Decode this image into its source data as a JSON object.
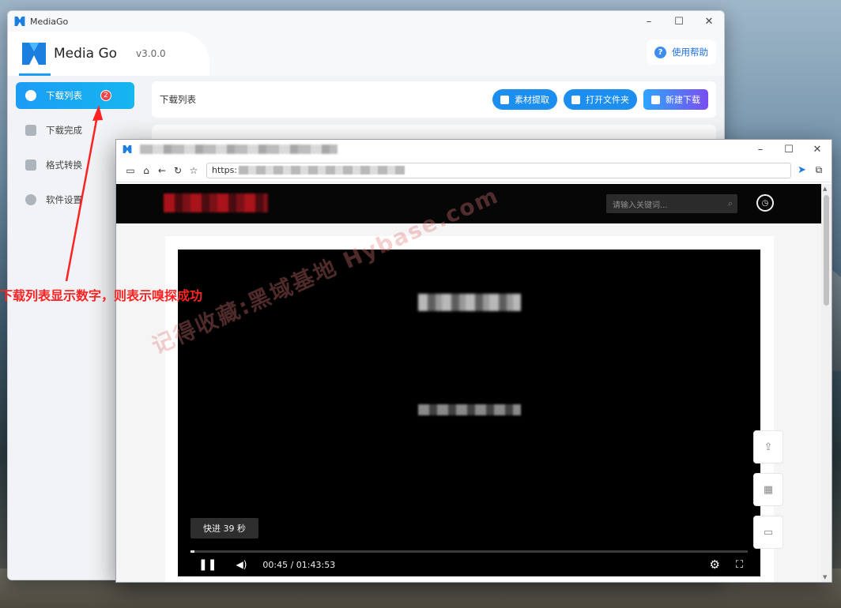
{
  "mediago": {
    "window_title": "MediaGo",
    "app_name": "Media Go",
    "version": "v3.0.0",
    "help_label": "使用帮助",
    "nav": [
      {
        "label": "下载列表",
        "badge": "2"
      },
      {
        "label": "下载完成"
      },
      {
        "label": "格式转换"
      },
      {
        "label": "软件设置"
      }
    ],
    "content_title": "下载列表",
    "actions": {
      "extract": "素材提取",
      "open_folder": "打开文件夹",
      "new_download": "新建下载"
    }
  },
  "browser": {
    "url_prefix": "https:",
    "search_placeholder": "请输入关键词...",
    "video": {
      "seek_tip": "快进 39 秒",
      "time": "00:45 / 01:43:53",
      "progress": 0.0072
    }
  },
  "annotation": {
    "text": "下载列表显示数字，则表示嗅探成功",
    "color": "#ff2222"
  },
  "watermark": "记得收藏:黑域基地  Hybase.com",
  "colors": {
    "accent": "#1b9cf5",
    "badge": "#f04848"
  }
}
